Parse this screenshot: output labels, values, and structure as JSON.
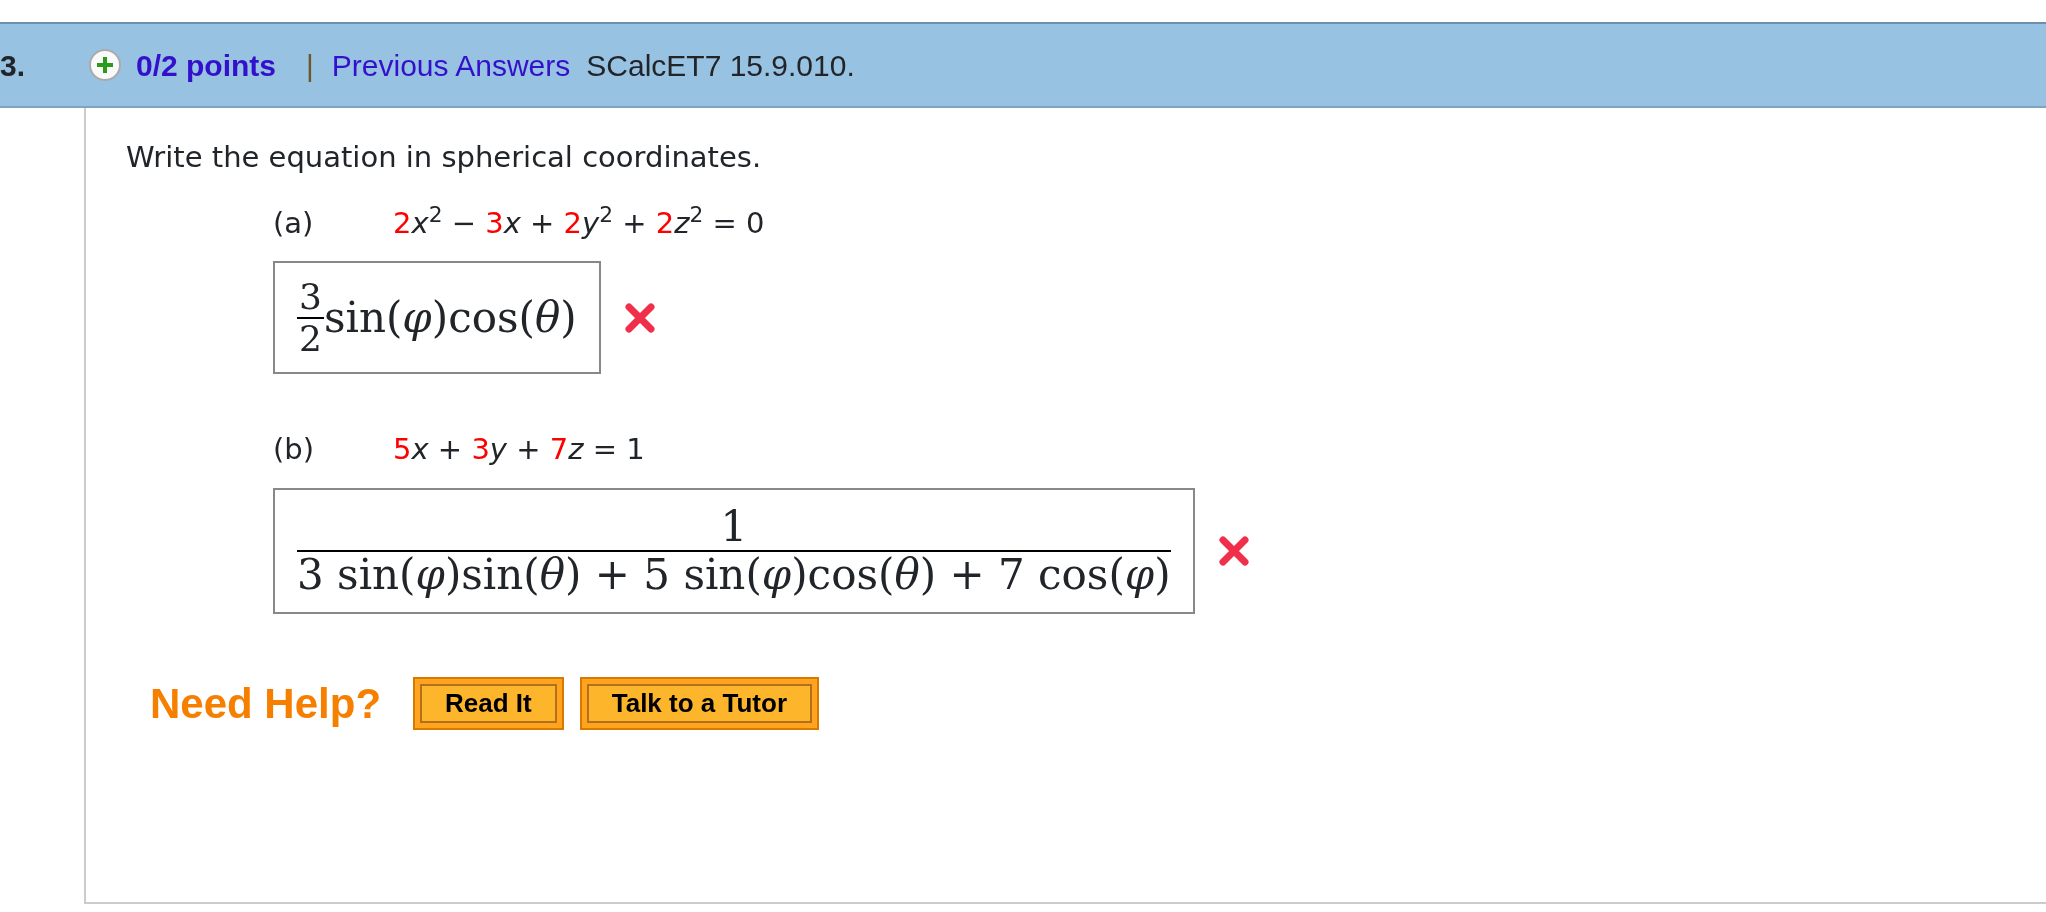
{
  "question": {
    "number": "3.",
    "points": "0/2 points",
    "separator": "|",
    "previous_answers": "Previous Answers",
    "source": "SCalcET7 15.9.010."
  },
  "prompt": "Write the equation in spherical coordinates.",
  "parts": [
    {
      "label": "(a)",
      "equation": [
        {
          "kind": "coef",
          "text": "2"
        },
        {
          "kind": "var",
          "text": "x"
        },
        {
          "kind": "sup",
          "text": "2"
        },
        {
          "kind": "op",
          "text": " − "
        },
        {
          "kind": "coef",
          "text": "3"
        },
        {
          "kind": "var",
          "text": "x"
        },
        {
          "kind": "op",
          "text": " + "
        },
        {
          "kind": "coef",
          "text": "2"
        },
        {
          "kind": "var",
          "text": "y"
        },
        {
          "kind": "sup",
          "text": "2"
        },
        {
          "kind": "op",
          "text": " + "
        },
        {
          "kind": "coef",
          "text": "2"
        },
        {
          "kind": "var",
          "text": "z"
        },
        {
          "kind": "sup",
          "text": "2"
        },
        {
          "kind": "op",
          "text": " = 0"
        }
      ],
      "answer": {
        "numerator": "3",
        "denominator": "2",
        "after": "sin(*φ*)cos(*θ*)"
      },
      "correct": false
    },
    {
      "label": "(b)",
      "equation": [
        {
          "kind": "coef",
          "text": "5"
        },
        {
          "kind": "var",
          "text": "x"
        },
        {
          "kind": "op",
          "text": " + "
        },
        {
          "kind": "coef",
          "text": "3"
        },
        {
          "kind": "var",
          "text": "y"
        },
        {
          "kind": "op",
          "text": " + "
        },
        {
          "kind": "coef",
          "text": "7"
        },
        {
          "kind": "var",
          "text": "z"
        },
        {
          "kind": "op",
          "text": " = 1"
        }
      ],
      "answer": {
        "numerator": "1",
        "denominator": "3 sin(*φ*)sin(*θ*) + 5 sin(*φ*)cos(*θ*) + 7 cos(*φ*)"
      },
      "correct": false
    }
  ],
  "help": {
    "label": "Need Help?",
    "buttons": [
      "Read It",
      "Talk to a Tutor"
    ]
  }
}
